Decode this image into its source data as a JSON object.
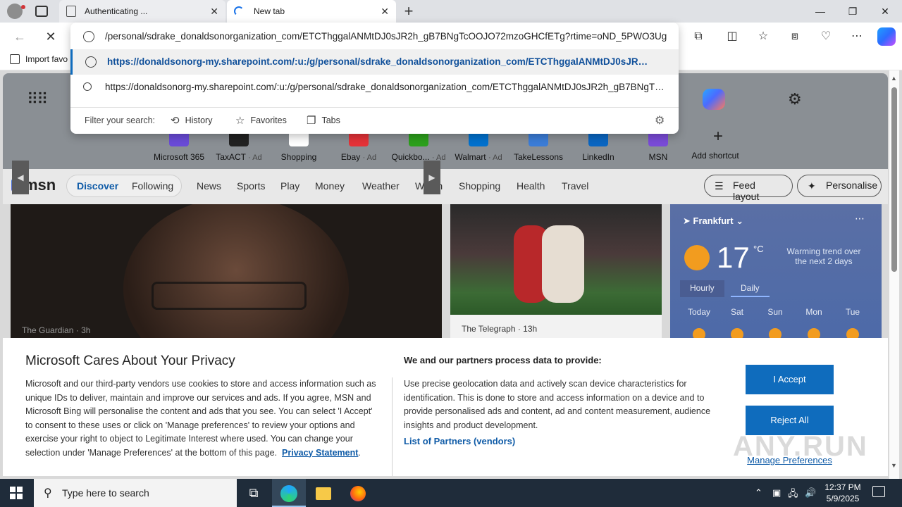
{
  "tabs": [
    {
      "label": "Authenticating ...",
      "close": "✕"
    },
    {
      "label": "New tab",
      "close": "✕"
    }
  ],
  "window_controls": {
    "minimize": "—",
    "maximize": "❐",
    "close": "✕"
  },
  "new_tab_glyph": "+",
  "toolbar": {
    "back": "←",
    "stop": "✕"
  },
  "address_bar": {
    "current_text": "/personal/sdrake_donaldsonorganization_com/ETCThggalANMtDJ0sJR2h_gB7BNgTcOOJO72mzoGHCfETg?rtime=oND_5PWO3Ug"
  },
  "suggestions": [
    {
      "type": "url",
      "text": "https://donaldsonorg-my.sharepoint.com/:u:/g/personal/sdrake_donaldsonorganization_com/ETCThggalANMtDJ0sJR…",
      "selected": true
    },
    {
      "type": "search",
      "text": "https://donaldsonorg-my.sharepoint.com/:u:/g/personal/sdrake_donaldsonorganization_com/ETCThggalANMtDJ0sJR2h_gB7BNgT…"
    }
  ],
  "filter": {
    "label": "Filter your search:",
    "chips": [
      "History",
      "Favorites",
      "Tabs"
    ]
  },
  "bookmarks": {
    "import_label": "Import favo"
  },
  "shortcuts": [
    {
      "name": "Microsoft 365",
      "ad": "",
      "color": "#6a4bd8"
    },
    {
      "name": "TaxACT",
      "ad": "· Ad",
      "color": "#222222"
    },
    {
      "name": "Shopping",
      "ad": "",
      "color": "#ffffff"
    },
    {
      "name": "Ebay",
      "ad": "· Ad",
      "color": "#e53238"
    },
    {
      "name": "Quickbo...",
      "ad": "· Ad",
      "color": "#2ca01c"
    },
    {
      "name": "Walmart",
      "ad": "· Ad",
      "color": "#0071ce"
    },
    {
      "name": "TakeLessons",
      "ad": "",
      "color": "#3b7dd8"
    },
    {
      "name": "LinkedIn",
      "ad": "",
      "color": "#0a66c2"
    },
    {
      "name": "MSN",
      "ad": "",
      "color": "#7a4bd8"
    }
  ],
  "add_shortcut": {
    "label": "Add shortcut",
    "glyph": "+"
  },
  "msn": {
    "logo": "msn",
    "discover": "Discover",
    "following": "Following",
    "nav": [
      "News",
      "Sports",
      "Play",
      "Money",
      "Weather",
      "Watch",
      "Shopping",
      "Health",
      "Travel"
    ],
    "feed_layout": "Feed layout",
    "personalise": "Personalise"
  },
  "hero": {
    "source": "The Guardian",
    "age": "3h"
  },
  "card2": {
    "source": "The Telegraph",
    "age": "13h"
  },
  "weather": {
    "location": "Frankfurt",
    "temp": "17",
    "unit": "°C",
    "trend": "Warming trend over the next 2 days",
    "tab_hourly": "Hourly",
    "tab_daily": "Daily",
    "days": [
      "Today",
      "Sat",
      "Sun",
      "Mon",
      "Tue"
    ]
  },
  "privacy": {
    "title": "Microsoft Cares About Your Privacy",
    "body": "Microsoft and our third-party vendors use cookies to store and access information such as unique IDs to deliver, maintain and improve our services and ads. If you agree, MSN and Microsoft Bing will personalise the content and ads that you see. You can select 'I Accept' to consent to these uses or click on 'Manage preferences' to review your options and exercise your right to object to Legitimate Interest where used.  You can change your selection under 'Manage Preferences' at the bottom of this page.",
    "privacy_link": "Privacy Statement",
    "heading2": "We and our partners process data to provide:",
    "text2": "Use precise geolocation data and actively scan device characteristics for identification. This is done to store and access information on a device and to provide personalised ads and content, ad and content measurement, audience insights and product development.",
    "partners_link": "List of Partners (vendors)",
    "accept": "I Accept",
    "reject": "Reject All",
    "manage": "Manage Preferences"
  },
  "watermark": "ANY.RUN",
  "taskbar": {
    "search_placeholder": "Type here to search",
    "time": "12:37 PM",
    "date": "5/9/2025"
  },
  "colors": {
    "accent": "#0f6cbd",
    "link": "#0f5ba7",
    "taskbar": "#1f2c3a"
  }
}
